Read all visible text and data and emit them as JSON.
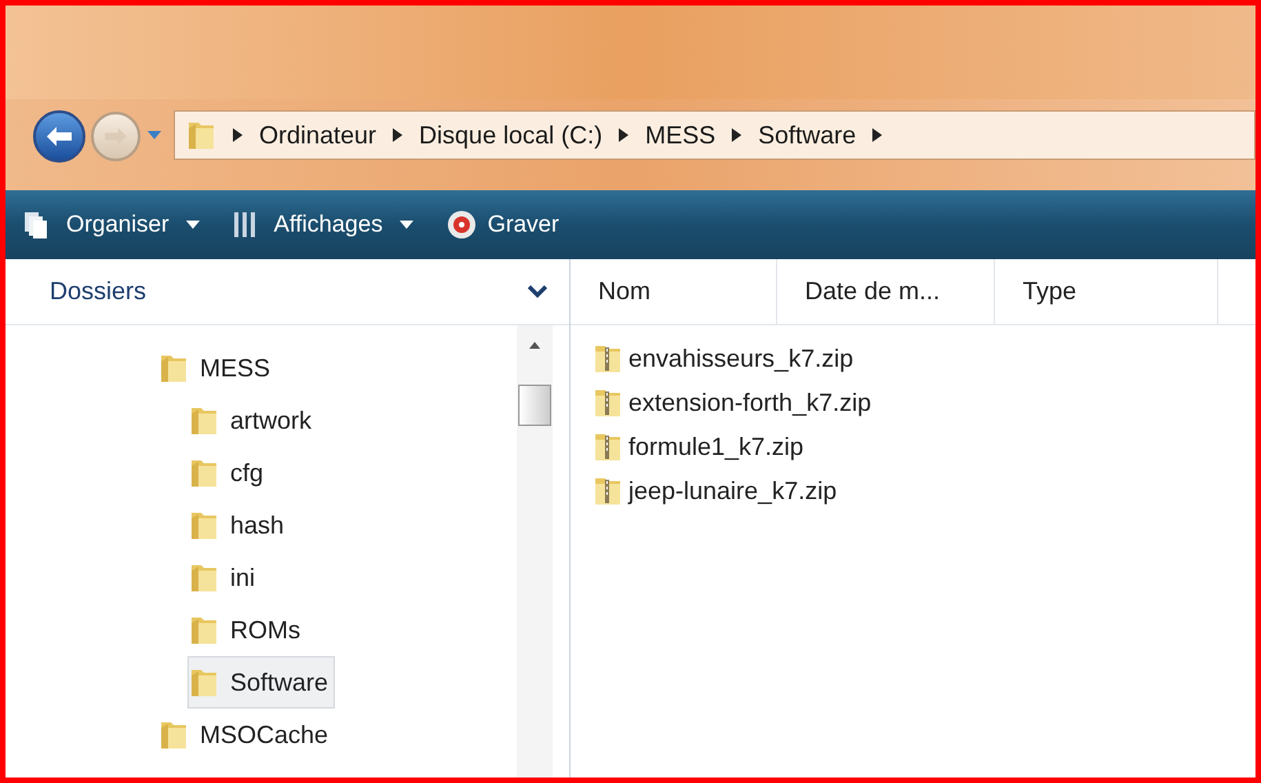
{
  "navigation": {
    "back_enabled": true,
    "forward_enabled": false
  },
  "breadcrumb": [
    "Ordinateur",
    "Disque local (C:)",
    "MESS",
    "Software"
  ],
  "toolbar": [
    {
      "label": "Organiser",
      "kind": "organize",
      "dropdown": true
    },
    {
      "label": "Affichages",
      "kind": "views",
      "dropdown": true
    },
    {
      "label": "Graver",
      "kind": "burn",
      "dropdown": false
    }
  ],
  "sidebar": {
    "title": "Dossiers",
    "items": [
      {
        "label": "MESS",
        "selected": false,
        "children": [
          {
            "label": "artwork",
            "selected": false
          },
          {
            "label": "cfg",
            "selected": false
          },
          {
            "label": "hash",
            "selected": false
          },
          {
            "label": "ini",
            "selected": false
          },
          {
            "label": "ROMs",
            "selected": false
          },
          {
            "label": "Software",
            "selected": true
          }
        ]
      },
      {
        "label": "MSOCache",
        "selected": false
      }
    ]
  },
  "file_list": {
    "columns": [
      "Nom",
      "Date de m...",
      "Type"
    ],
    "files": [
      "envahisseurs_k7.zip",
      "extension-forth_k7.zip",
      "formule1_k7.zip",
      "jeep-lunaire_k7.zip"
    ]
  }
}
